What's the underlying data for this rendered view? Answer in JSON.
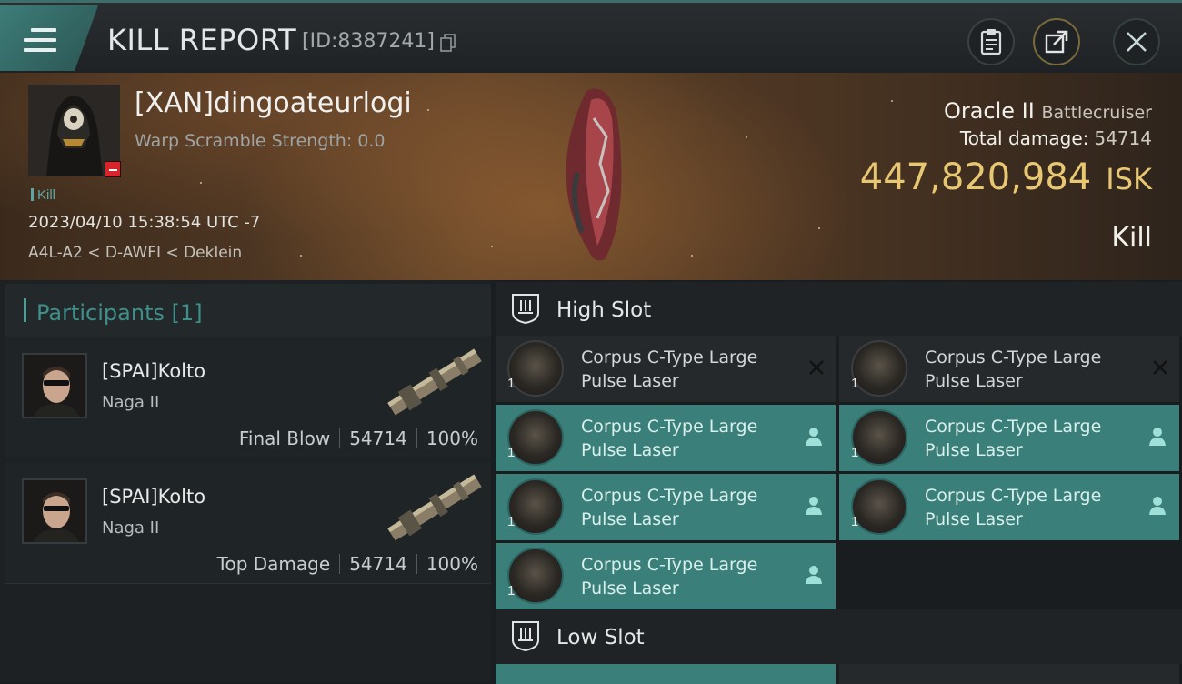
{
  "header": {
    "title": "KILL REPORT",
    "report_id": "[ID:8387241]",
    "menu_icon": "hamburger-menu-icon",
    "buttons": [
      {
        "name": "clipboard-button",
        "icon": "clipboard-icon"
      },
      {
        "name": "share-button",
        "icon": "external-share-icon"
      },
      {
        "name": "close-button",
        "icon": "close-icon"
      }
    ]
  },
  "victim": {
    "pilot": "[XAN]dingoateurlogi",
    "warp_scramble": "Warp Scramble Strength: 0.0",
    "tag": "Kill",
    "datetime": "2023/04/10 15:38:54 UTC -7",
    "location": "A4L-A2 < D-AWFI < Deklein",
    "ship": "Oracle II",
    "ship_class": "Battlecruiser",
    "total_damage_label": "Total damage:",
    "total_damage": "54714",
    "isk_value": "447,820,984",
    "isk_unit": "ISK",
    "result": "Kill"
  },
  "participants": {
    "label": "Participants [1]",
    "rows": [
      {
        "name": "[SPAI]Kolto",
        "ship": "Naga II",
        "role": "Final Blow",
        "damage": "54714",
        "percent": "100%"
      },
      {
        "name": "[SPAI]Kolto",
        "ship": "Naga II",
        "role": "Top Damage",
        "damage": "54714",
        "percent": "100%"
      }
    ]
  },
  "slots": {
    "high": {
      "title": "High Slot",
      "modules": [
        {
          "line1": "Corpus C-Type Large",
          "line2": "Pulse Laser",
          "qty": "1",
          "state": "destroyed"
        },
        {
          "line1": "Corpus C-Type Large",
          "line2": "Pulse Laser",
          "qty": "1",
          "state": "destroyed"
        },
        {
          "line1": "Corpus C-Type Large",
          "line2": "Pulse Laser",
          "qty": "1",
          "state": "dropped"
        },
        {
          "line1": "Corpus C-Type Large",
          "line2": "Pulse Laser",
          "qty": "1",
          "state": "dropped"
        },
        {
          "line1": "Corpus C-Type Large",
          "line2": "Pulse Laser",
          "qty": "1",
          "state": "dropped"
        },
        {
          "line1": "Corpus C-Type Large",
          "line2": "Pulse Laser",
          "qty": "1",
          "state": "dropped"
        },
        {
          "line1": "Corpus C-Type Large",
          "line2": "Pulse Laser",
          "qty": "1",
          "state": "dropped"
        }
      ]
    },
    "low": {
      "title": "Low Slot"
    }
  },
  "colors": {
    "accent_teal": "#3b7f7a",
    "isk_gold": "#e8c773",
    "badge_red": "#d6262b"
  }
}
